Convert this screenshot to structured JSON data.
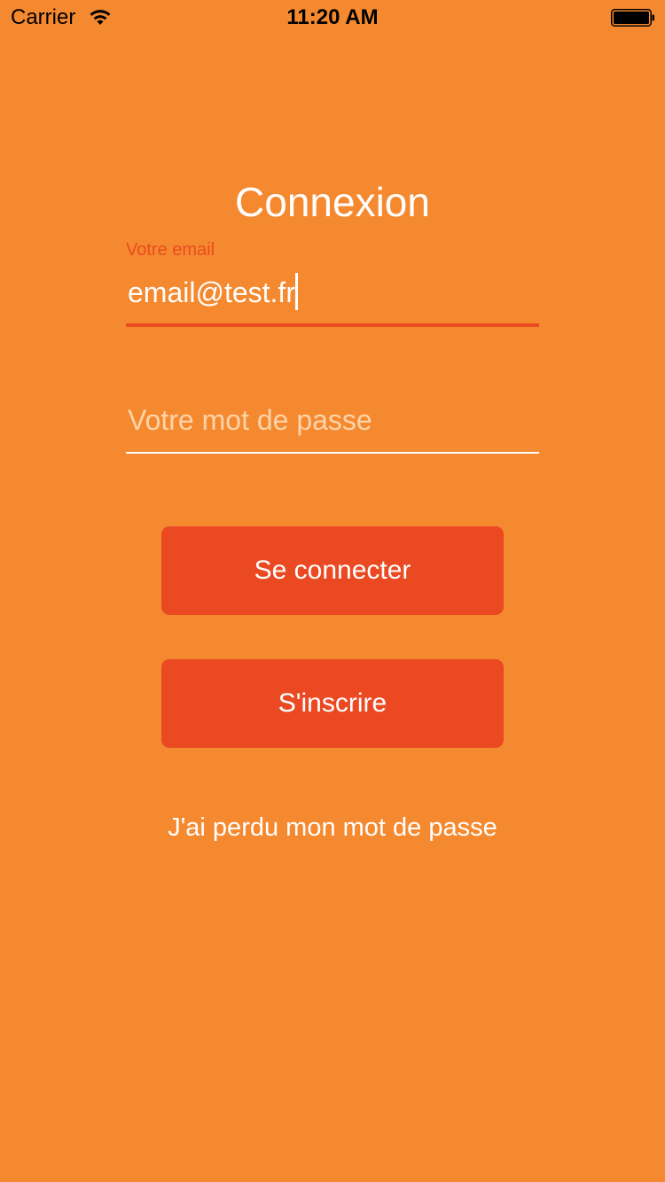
{
  "status_bar": {
    "carrier": "Carrier",
    "time": "11:20 AM",
    "wifi_icon": "wifi-icon",
    "battery_icon": "battery-icon",
    "battery_level": 1.0
  },
  "login": {
    "title": "Connexion",
    "email": {
      "label": "Votre email",
      "value": "email@test.fr",
      "focused": true
    },
    "password": {
      "placeholder": "Votre mot de passe",
      "value": ""
    },
    "login_button": "Se connecter",
    "signup_button": "S'inscrire",
    "forgot_link": "J'ai perdu mon mot de passe"
  },
  "colors": {
    "background": "#F5892F",
    "accent": "#EA4922",
    "label_active": "#EA4B20",
    "text": "#FFFFFF"
  }
}
